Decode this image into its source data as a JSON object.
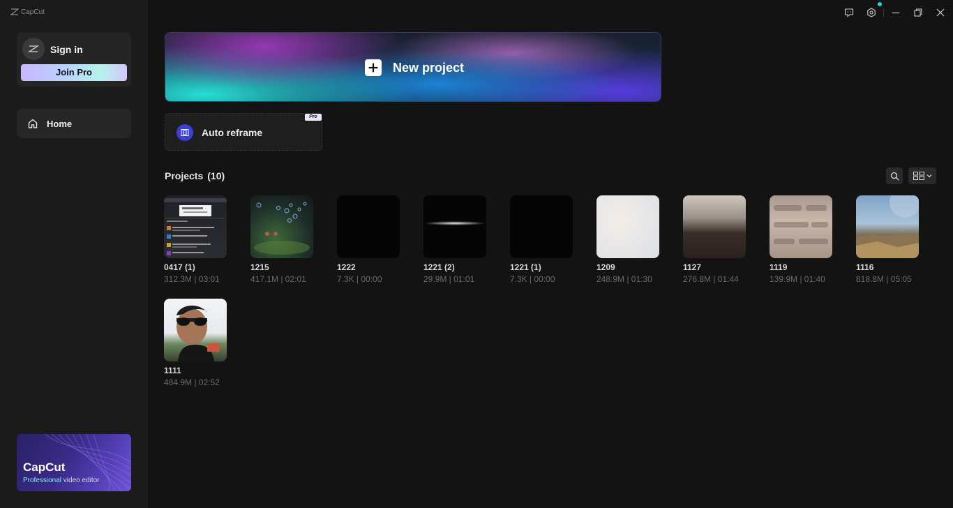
{
  "app": {
    "name": "CapCut"
  },
  "account": {
    "sign_in_label": "Sign in",
    "join_pro_label": "Join Pro"
  },
  "nav": {
    "home_label": "Home"
  },
  "promo": {
    "title": "CapCut",
    "subtitle_highlight": "Professional",
    "subtitle_rest": " video editor"
  },
  "titlebar": {
    "icons": [
      "feedback-icon",
      "settings-icon",
      "minimize-icon",
      "restore-icon",
      "close-icon"
    ],
    "notification_color": "#22d3e6"
  },
  "actions": {
    "new_project_label": "New project",
    "auto_reframe_label": "Auto reframe",
    "pro_badge": "Pro"
  },
  "projects": {
    "title": "Projects",
    "count": "(10)",
    "items": [
      {
        "name": "0417 (1)",
        "meta": "312.3M | 03:01"
      },
      {
        "name": "1215",
        "meta": "417.1M | 02:01"
      },
      {
        "name": "1222",
        "meta": "7.3K | 00:00"
      },
      {
        "name": "1221 (2)",
        "meta": "29.9M | 01:01"
      },
      {
        "name": "1221 (1)",
        "meta": "7.3K | 00:00"
      },
      {
        "name": "1209",
        "meta": "248.9M | 01:30"
      },
      {
        "name": "1127",
        "meta": "276.8M | 01:44"
      },
      {
        "name": "1119",
        "meta": "139.9M | 01:40"
      },
      {
        "name": "1116",
        "meta": "818.8M | 05:05"
      },
      {
        "name": "1111",
        "meta": "484.9M | 02:52"
      }
    ]
  }
}
